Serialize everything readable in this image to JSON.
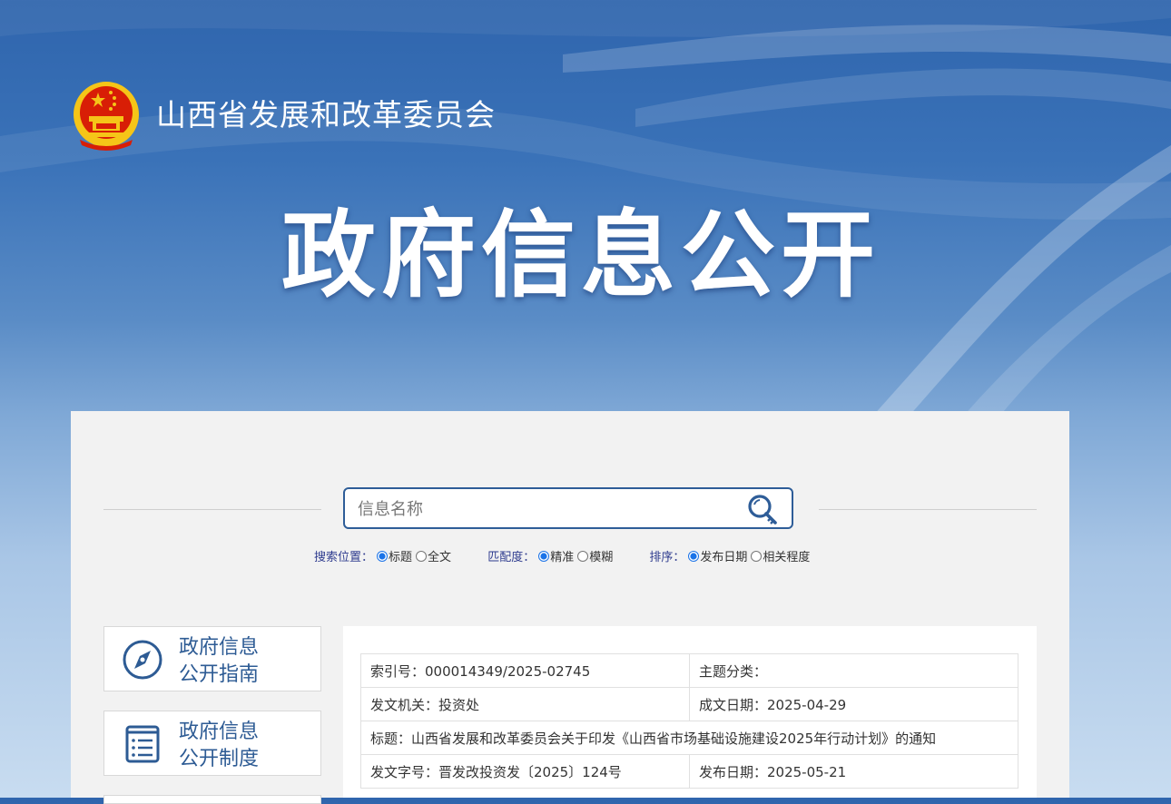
{
  "header": {
    "org_name": "山西省发展和改革委员会",
    "hero_title": "政府信息公开"
  },
  "search": {
    "placeholder": "信息名称",
    "position": {
      "label": "搜索位置：",
      "options": [
        "标题",
        "全文"
      ],
      "selected": "标题"
    },
    "match": {
      "label": "匹配度：",
      "options": [
        "精准",
        "模糊"
      ],
      "selected": "精准"
    },
    "sort": {
      "label": "排序：",
      "options": [
        "发布日期",
        "相关程度"
      ],
      "selected": "发布日期"
    }
  },
  "sidebar": {
    "items": [
      {
        "line1": "政府信息",
        "line2": "公开指南",
        "icon": "compass-icon"
      },
      {
        "line1": "政府信息",
        "line2": "公开制度",
        "icon": "document-list-icon"
      }
    ]
  },
  "document": {
    "index_no": "索引号：000014349/2025-02745",
    "topic": "主题分类：",
    "issuer": "发文机关：投资处",
    "written_date": "成文日期：2025-04-29",
    "title": "标题：山西省发展和改革委员会关于印发《山西省市场基础设施建设2025年行动计划》的通知",
    "doc_no": "发文字号：晋发改投资发〔2025〕124号",
    "publish_date": "发布日期：2025-05-21"
  },
  "colors": {
    "accent": "#2e5d98",
    "label": "#2f3c8f",
    "emblem_red": "#d81e06",
    "emblem_gold": "#f5c518"
  }
}
